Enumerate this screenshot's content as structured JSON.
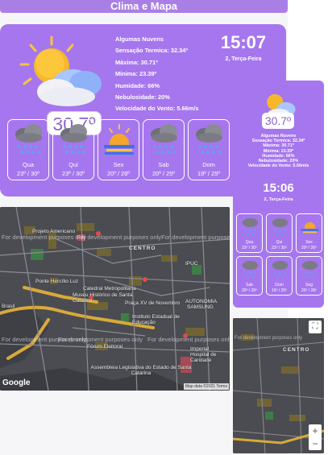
{
  "header": {
    "title": "Clima e Mapa"
  },
  "current": {
    "temperature": "30.7º",
    "condition": "Algumas Nuvens",
    "feels_like": "Sensação Termica: 32.34º",
    "max": "Máxima: 30.71º",
    "min": "Mínima: 23.39º",
    "humidity": "Humidade: 66%",
    "cloudiness": "Nebulosidade: 20%",
    "wind": "Velocidade do Vento: 5.66m/s",
    "time": "15:07",
    "date": "2, Terça-Feira"
  },
  "forecast": [
    {
      "day": "Qua",
      "range": "23º / 30º",
      "icon": "rain-cloud-icon"
    },
    {
      "day": "Qui",
      "range": "23º / 30º",
      "icon": "rain-cloud-icon"
    },
    {
      "day": "Sex",
      "range": "20º / 26º",
      "icon": "sunset-icon"
    },
    {
      "day": "Sab",
      "range": "20º / 25º",
      "icon": "rain-cloud-icon"
    },
    {
      "day": "Dom",
      "range": "19º / 25º",
      "icon": "rain-cloud-icon"
    }
  ],
  "map": {
    "watermark": "For development purposes only",
    "labels": {
      "centro": "CENTRO",
      "catedral": "Catedral Metropolitana",
      "museu": "Museu Histórico de Santa Catarina",
      "praca": "Praça XV de Novembro",
      "instituto": "Instituto Estadual de Educação",
      "imperial": "Imperial Hospital de Caridade",
      "assembleia": "Assembleia Legislativa do Estado de Santa Catarina",
      "forum": "Fórum Eleitoral",
      "ponte": "Ponte Hercílio Luz",
      "ipuc": "IPUC",
      "autonoma": "AUTONOMIA",
      "samsung": "SAMSUNG",
      "padaria": "Padaria Nerosano",
      "brasil": "Brasil",
      "projeto": "Projeto Americano",
      "portal": "Portal Ipuc"
    },
    "logo": "Google",
    "attribution": "Map data ©2021  Terms"
  },
  "side": {
    "temperature": "30.7º",
    "condition": "Algumas Nuvens",
    "feels_like": "Sensação Termica: 32.34º",
    "max": "Máxima: 30.71º",
    "min": "Mínima: 23.39º",
    "humidity": "Humidade: 66%",
    "cloudiness": "Nebulosidade: 20%",
    "wind": "Velocidade do Vento: 5.66m/s",
    "time": "15:06",
    "date": "2, Terça-Feira",
    "forecast": [
      {
        "day": "Qua",
        "range": "23º / 30º",
        "icon": "rain-cloud-icon"
      },
      {
        "day": "Qui",
        "range": "23º / 30º",
        "icon": "rain-cloud-icon"
      },
      {
        "day": "Sex",
        "range": "20º / 26º",
        "icon": "sunset-icon"
      },
      {
        "day": "Sab",
        "range": "20º / 25º",
        "icon": "rain-cloud-icon"
      },
      {
        "day": "Dom",
        "range": "19º / 25º",
        "icon": "rain-cloud-icon"
      },
      {
        "day": "Seg",
        "range": "20º / 26º",
        "icon": "rain-cloud-icon"
      }
    ],
    "map": {
      "centro": "CENTRO",
      "watermark": "For development purposes only"
    }
  },
  "colors": {
    "card": "#a676ee",
    "header": "#a97fe6",
    "map": "#4b4d52"
  }
}
